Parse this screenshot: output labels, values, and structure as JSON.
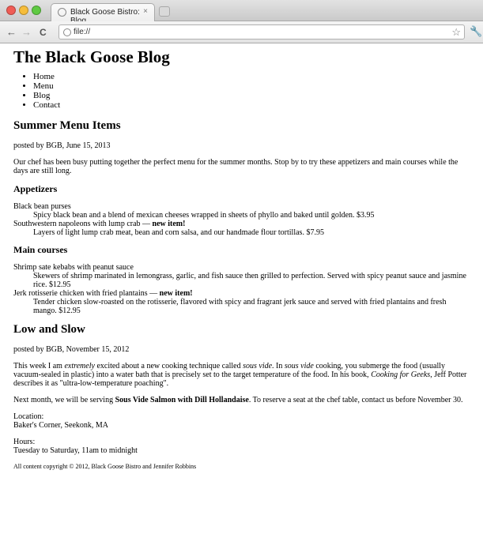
{
  "browser": {
    "tab_title": "Black Goose Bistro: Blog",
    "tab_close": "×",
    "url": "file://",
    "back_glyph": "←",
    "forward_glyph": "→",
    "reload_glyph": "C",
    "star_glyph": "☆",
    "wrench_glyph": "🔧"
  },
  "page": {
    "title": "The Black Goose Blog",
    "nav": [
      "Home",
      "Menu",
      "Blog",
      "Contact"
    ],
    "post1": {
      "heading": "Summer Menu Items",
      "byline": "posted by BGB, June 15, 2013",
      "intro": "Our chef has been busy putting together the perfect menu for the summer months. Stop by to try these appetizers and main courses while the days are still long.",
      "appetizers_heading": "Appetizers",
      "appetizers": [
        {
          "name": "Black bean purses",
          "desc": "Spicy black bean and a blend of mexican cheeses wrapped in sheets of phyllo and baked until golden. $3.95"
        },
        {
          "name": "Southwestern napoleons with lump crab — ",
          "badge": "new item!",
          "desc": "Layers of light lump crab meat, bean and corn salsa, and our handmade flour tortillas. $7.95"
        }
      ],
      "mains_heading": "Main courses",
      "mains": [
        {
          "name": "Shrimp sate kebabs with peanut sauce",
          "desc": "Skewers of shrimp marinated in lemongrass, garlic, and fish sauce then grilled to perfection. Served with spicy peanut sauce and jasmine rice. $12.95"
        },
        {
          "name": "Jerk rotisserie chicken with fried plantains — ",
          "badge": "new item!",
          "desc": "Tender chicken slow-roasted on the rotisserie, flavored with spicy and fragrant jerk sauce and served with fried plantains and fresh mango. $12.95"
        }
      ]
    },
    "post2": {
      "heading": "Low and Slow",
      "byline": "posted by BGB, November 15, 2012",
      "p1_a": "This week I am ",
      "p1_em1": "extremely",
      "p1_b": " excited about a new cooking technique called ",
      "p1_em2": "sous vide",
      "p1_c": ". In ",
      "p1_em3": "sous vide",
      "p1_d": " cooking, you submerge the food (usually vacuum-sealed in plastic) into a water bath that is precisely set to the target temperature of the food. In his book, ",
      "p1_em4": "Cooking for Geeks",
      "p1_e": ", Jeff Potter describes it as \"ultra-low-temperature poaching\".",
      "p2_a": "Next month, we will be serving ",
      "p2_strong": "Sous Vide Salmon with Dill Hollandaise",
      "p2_b": ". To reserve a seat at the chef table, contact us before November 30."
    },
    "location_label": "Location:",
    "location_value": "Baker's Corner, Seekonk, MA",
    "hours_label": "Hours:",
    "hours_value": "Tuesday to Saturday, 11am to midnight",
    "copyright": "All content copyright © 2012, Black Goose Bistro and Jennifer Robbins"
  }
}
